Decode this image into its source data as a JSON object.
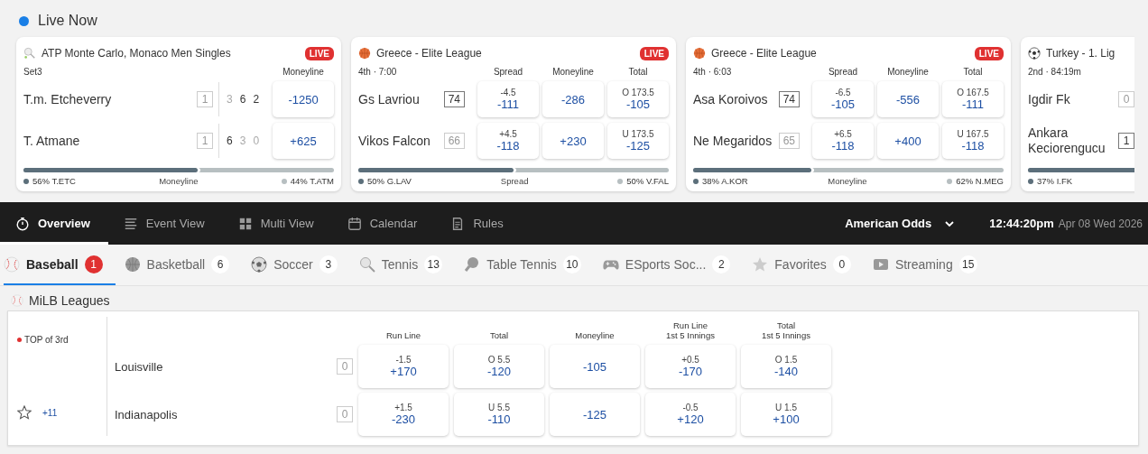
{
  "live_now": {
    "title": "Live Now",
    "cards": [
      {
        "kind": "tennis",
        "league": "ATP Monte Carlo, Monaco Men Singles",
        "live": true,
        "live_label": "LIVE",
        "period": "Set3",
        "markets": [
          "Moneyline"
        ],
        "teams": [
          {
            "name": "T.m. Etcheverry",
            "score": "1",
            "leading": false,
            "sets": [
              {
                "value": "3",
                "won": false
              },
              {
                "value": "6",
                "won": true
              },
              {
                "value": "2",
                "won": true
              }
            ],
            "odds": [
              {
                "price": "-1250"
              }
            ]
          },
          {
            "name": "T. Atmane",
            "score": "1",
            "leading": false,
            "sets": [
              {
                "value": "6",
                "won": true
              },
              {
                "value": "3",
                "won": false
              },
              {
                "value": "0",
                "won": false
              }
            ],
            "odds": [
              {
                "price": "+625"
              }
            ]
          }
        ],
        "split": {
          "left": "56% T.ETC",
          "market": "Moneyline",
          "right": "44% T.ATM",
          "level": 0.56
        }
      },
      {
        "kind": "basketball",
        "league": "Greece - Elite League",
        "live": true,
        "live_label": "LIVE",
        "period": "4th · 7:00",
        "markets": [
          "Spread",
          "Moneyline",
          "Total"
        ],
        "teams": [
          {
            "name": "Gs Lavriou",
            "score": "74",
            "leading": true,
            "odds": [
              {
                "line": "-4.5",
                "price": "-111"
              },
              {
                "price": "-286"
              },
              {
                "line": "O 173.5",
                "price": "-105"
              }
            ]
          },
          {
            "name": "Vikos Falcon",
            "score": "66",
            "leading": false,
            "odds": [
              {
                "line": "+4.5",
                "price": "-118"
              },
              {
                "price": "+230"
              },
              {
                "line": "U 173.5",
                "price": "-125"
              }
            ]
          }
        ],
        "split": {
          "left": "50% G.LAV",
          "market": "Spread",
          "right": "50% V.FAL",
          "level": 0.5
        }
      },
      {
        "kind": "basketball",
        "league": "Greece - Elite League",
        "live": true,
        "live_label": "LIVE",
        "period": "4th · 6:03",
        "markets": [
          "Spread",
          "Moneyline",
          "Total"
        ],
        "teams": [
          {
            "name": "Asa Koroivos",
            "score": "74",
            "leading": true,
            "odds": [
              {
                "line": "-6.5",
                "price": "-105"
              },
              {
                "price": "-556"
              },
              {
                "line": "O 167.5",
                "price": "-111"
              }
            ]
          },
          {
            "name": "Ne Megaridos",
            "score": "65",
            "leading": false,
            "odds": [
              {
                "line": "+6.5",
                "price": "-118"
              },
              {
                "price": "+400"
              },
              {
                "line": "U 167.5",
                "price": "-118"
              }
            ]
          }
        ],
        "split": {
          "left": "38% A.KOR",
          "market": "Moneyline",
          "right": "62% N.MEG",
          "level": 0.38
        }
      },
      {
        "kind": "soccer",
        "league": "Turkey - 1. Lig",
        "period": "2nd · 84:19m",
        "teams": [
          {
            "name": "Igdir Fk",
            "score": "0",
            "leading": false
          },
          {
            "name": "Ankara Keciorengucu",
            "score": "1",
            "leading": true
          }
        ],
        "split": {
          "left": "37% I.FK",
          "level": 0.37
        }
      }
    ]
  },
  "nav": {
    "items": [
      {
        "label": "Overview",
        "selected": true
      },
      {
        "label": "Event View",
        "selected": false
      },
      {
        "label": "Multi View",
        "selected": false
      },
      {
        "label": "Calendar",
        "selected": false
      },
      {
        "label": "Rules",
        "selected": false
      }
    ],
    "odds_format": "American Odds",
    "time": "12:44:20pm",
    "date": "Apr 08 Wed 2026"
  },
  "sport_tabs": [
    {
      "label": "Baseball",
      "count": "1",
      "selected": true
    },
    {
      "label": "Basketball",
      "count": "6",
      "selected": false
    },
    {
      "label": "Soccer",
      "count": "3",
      "selected": false
    },
    {
      "label": "Tennis",
      "count": "13",
      "selected": false
    },
    {
      "label": "Table Tennis",
      "count": "10",
      "selected": false
    },
    {
      "label": "ESports Soc...",
      "count": "2",
      "selected": false
    },
    {
      "label": "Favorites",
      "count": "0",
      "selected": false
    },
    {
      "label": "Streaming",
      "count": "15",
      "selected": false
    }
  ],
  "league": {
    "title": "MiLB Leagues",
    "columns": [
      {
        "label": "Run Line"
      },
      {
        "label": "Total"
      },
      {
        "label": "Moneyline"
      },
      {
        "label": "Run Line",
        "sub": "1st 5 Innings"
      },
      {
        "label": "Total",
        "sub": "1st 5 Innings"
      }
    ],
    "events": [
      {
        "status": "TOP of 3rd",
        "live": true,
        "favorite": false,
        "more": "+11",
        "teams": [
          {
            "name": "Louisville",
            "score": "0",
            "odds": [
              {
                "line": "-1.5",
                "price": "+170"
              },
              {
                "line": "O 5.5",
                "price": "-120"
              },
              {
                "price": "-105"
              },
              {
                "line": "+0.5",
                "price": "-170"
              },
              {
                "line": "O 1.5",
                "price": "-140"
              }
            ]
          },
          {
            "name": "Indianapolis",
            "score": "0",
            "odds": [
              {
                "line": "+1.5",
                "price": "-230"
              },
              {
                "line": "U 5.5",
                "price": "-110"
              },
              {
                "price": "-125"
              },
              {
                "line": "-0.5",
                "price": "+120"
              },
              {
                "line": "U 1.5",
                "price": "+100"
              }
            ]
          }
        ]
      }
    ]
  }
}
